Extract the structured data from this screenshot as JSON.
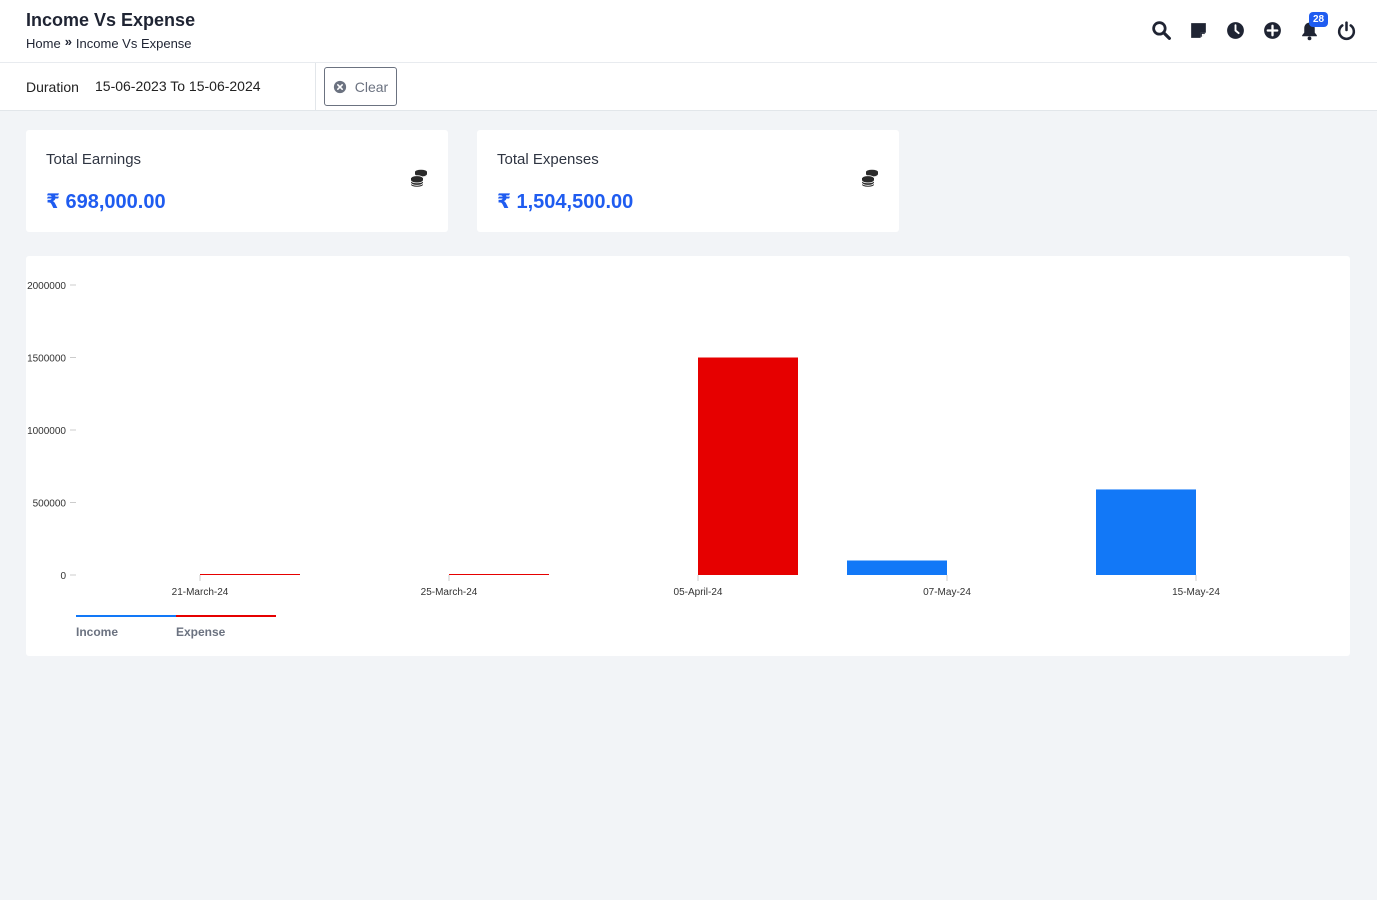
{
  "header": {
    "title": "Income Vs Expense",
    "breadcrumb": {
      "home": "Home",
      "separator": "»",
      "current": "Income Vs Expense"
    },
    "actions": [
      {
        "name": "search-icon"
      },
      {
        "name": "sticky-note-icon"
      },
      {
        "name": "clock-icon"
      },
      {
        "name": "plus-circle-icon"
      },
      {
        "name": "bell-icon",
        "badge": "28"
      },
      {
        "name": "power-icon"
      }
    ]
  },
  "filter": {
    "duration_label": "Duration",
    "duration_value": "15-06-2023 To 15-06-2024",
    "clear_label": "Clear"
  },
  "cards": [
    {
      "title": "Total Earnings",
      "value": "₹ 698,000.00",
      "icon": "coins-icon"
    },
    {
      "title": "Total Expenses",
      "value": "₹ 1,504,500.00",
      "icon": "coins-icon"
    }
  ],
  "colors": {
    "accent": "#1f5cf0",
    "income": "#1278f7",
    "expense": "#e60000"
  },
  "chart_data": {
    "type": "bar",
    "categories": [
      "21-March-24",
      "25-March-24",
      "05-April-24",
      "07-May-24",
      "15-May-24"
    ],
    "y_ticks": [
      "0",
      "500000",
      "1000000",
      "1500000",
      "2000000"
    ],
    "ylim": [
      0,
      2000000
    ],
    "series": [
      {
        "name": "Income",
        "color": "#1278f7",
        "values": [
          0,
          0,
          0,
          100000,
          590000
        ]
      },
      {
        "name": "Expense",
        "color": "#e60000",
        "values": [
          4000,
          2000,
          1500000,
          0,
          0
        ]
      }
    ],
    "legend": "bottom-left",
    "grid": false
  }
}
